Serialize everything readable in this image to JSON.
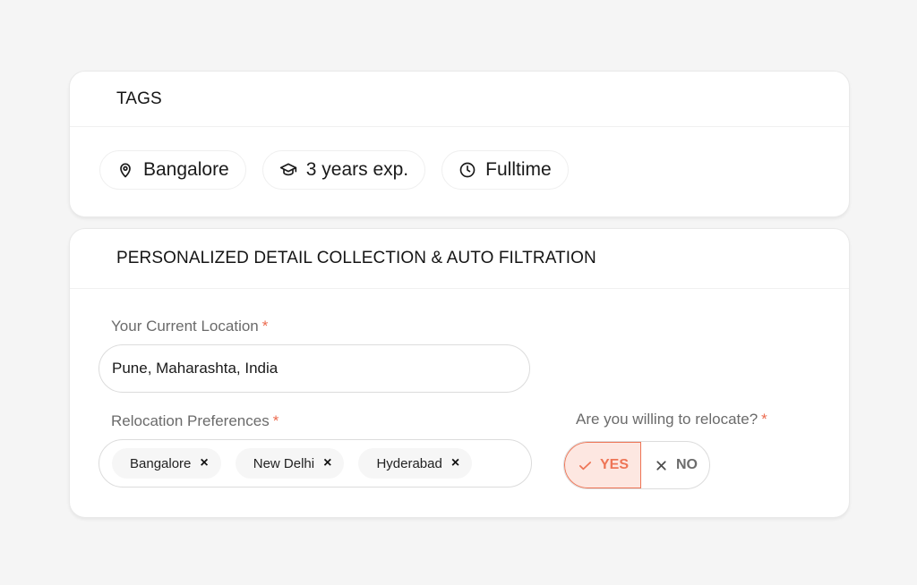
{
  "tags_card": {
    "title": "TAGS",
    "tags": [
      {
        "icon": "map-pin-icon",
        "label": "Bangalore"
      },
      {
        "icon": "graduation-cap-icon",
        "label": "3 years exp."
      },
      {
        "icon": "clock-icon",
        "label": "Fulltime"
      }
    ]
  },
  "detail_card": {
    "title": "PERSONALIZED DETAIL COLLECTION & AUTO FILTRATION",
    "current_location": {
      "label": "Your Current Location",
      "required_mark": "*",
      "value": "Pune, Maharashta, India"
    },
    "relocation_preferences": {
      "label": "Relocation Preferences",
      "required_mark": "*",
      "chips": [
        "Bangalore",
        "New Delhi",
        "Hyderabad"
      ],
      "remove_glyph": "×"
    },
    "willing_to_relocate": {
      "label": "Are you willing to relocate?",
      "required_mark": "*",
      "yes_label": "YES",
      "no_label": "NO",
      "selected": "YES"
    }
  },
  "colors": {
    "accent": "#ee7556",
    "accent_bg": "#fde7e1",
    "required": "#ec6b4f"
  }
}
